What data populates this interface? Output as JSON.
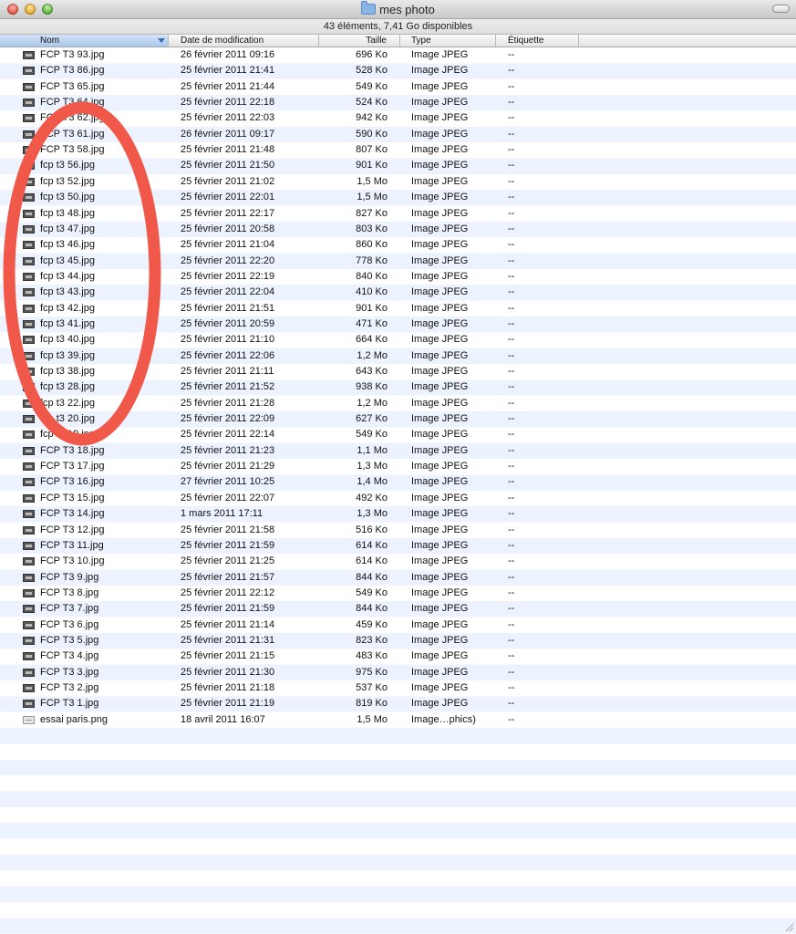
{
  "window": {
    "title": "mes photo"
  },
  "status": {
    "text": "43 éléments, 7,41 Go disponibles"
  },
  "columns": {
    "name": "Nom",
    "date": "Date de modification",
    "size": "Taille",
    "type": "Type",
    "label": "Étiquette"
  },
  "accent_color": "#f0584a",
  "files": [
    {
      "name": "FCP T3 93.jpg",
      "date": "26 février 2011 09:16",
      "size": "696 Ko",
      "type": "Image JPEG",
      "label": "--"
    },
    {
      "name": "FCP T3 86.jpg",
      "date": "25 février 2011 21:41",
      "size": "528 Ko",
      "type": "Image JPEG",
      "label": "--"
    },
    {
      "name": "FCP T3 65.jpg",
      "date": "25 février 2011 21:44",
      "size": "549 Ko",
      "type": "Image JPEG",
      "label": "--"
    },
    {
      "name": "FCP T3 64.jpg",
      "date": "25 février 2011 22:18",
      "size": "524 Ko",
      "type": "Image JPEG",
      "label": "--"
    },
    {
      "name": "FCP T3 62.jpg",
      "date": "25 février 2011 22:03",
      "size": "942 Ko",
      "type": "Image JPEG",
      "label": "--"
    },
    {
      "name": "FCP T3 61.jpg",
      "date": "26 février 2011 09:17",
      "size": "590 Ko",
      "type": "Image JPEG",
      "label": "--"
    },
    {
      "name": "FCP T3 58.jpg",
      "date": "25 février 2011 21:48",
      "size": "807 Ko",
      "type": "Image JPEG",
      "label": "--"
    },
    {
      "name": "fcp t3 56.jpg",
      "date": "25 février 2011 21:50",
      "size": "901 Ko",
      "type": "Image JPEG",
      "label": "--"
    },
    {
      "name": "fcp t3 52.jpg",
      "date": "25 février 2011 21:02",
      "size": "1,5 Mo",
      "type": "Image JPEG",
      "label": "--"
    },
    {
      "name": "fcp t3 50.jpg",
      "date": "25 février 2011 22:01",
      "size": "1,5 Mo",
      "type": "Image JPEG",
      "label": "--"
    },
    {
      "name": "fcp t3 48.jpg",
      "date": "25 février 2011 22:17",
      "size": "827 Ko",
      "type": "Image JPEG",
      "label": "--"
    },
    {
      "name": "fcp t3 47.jpg",
      "date": "25 février 2011 20:58",
      "size": "803 Ko",
      "type": "Image JPEG",
      "label": "--"
    },
    {
      "name": "fcp t3 46.jpg",
      "date": "25 février 2011 21:04",
      "size": "860 Ko",
      "type": "Image JPEG",
      "label": "--"
    },
    {
      "name": "fcp t3 45.jpg",
      "date": "25 février 2011 22:20",
      "size": "778 Ko",
      "type": "Image JPEG",
      "label": "--"
    },
    {
      "name": "fcp t3 44.jpg",
      "date": "25 février 2011 22:19",
      "size": "840 Ko",
      "type": "Image JPEG",
      "label": "--"
    },
    {
      "name": "fcp t3 43.jpg",
      "date": "25 février 2011 22:04",
      "size": "410 Ko",
      "type": "Image JPEG",
      "label": "--"
    },
    {
      "name": "fcp t3 42.jpg",
      "date": "25 février 2011 21:51",
      "size": "901 Ko",
      "type": "Image JPEG",
      "label": "--"
    },
    {
      "name": "fcp t3 41.jpg",
      "date": "25 février 2011 20:59",
      "size": "471 Ko",
      "type": "Image JPEG",
      "label": "--"
    },
    {
      "name": "fcp t3 40.jpg",
      "date": "25 février 2011 21:10",
      "size": "664 Ko",
      "type": "Image JPEG",
      "label": "--"
    },
    {
      "name": "fcp t3 39.jpg",
      "date": "25 février 2011 22:06",
      "size": "1,2 Mo",
      "type": "Image JPEG",
      "label": "--"
    },
    {
      "name": "fcp t3 38.jpg",
      "date": "25 février 2011 21:11",
      "size": "643 Ko",
      "type": "Image JPEG",
      "label": "--"
    },
    {
      "name": "fcp t3 28.jpg",
      "date": "25 février 2011 21:52",
      "size": "938 Ko",
      "type": "Image JPEG",
      "label": "--"
    },
    {
      "name": "fcp t3 22.jpg",
      "date": "25 février 2011 21:28",
      "size": "1,2 Mo",
      "type": "Image JPEG",
      "label": "--"
    },
    {
      "name": "fcp t3 20.jpg",
      "date": "25 février 2011 22:09",
      "size": "627 Ko",
      "type": "Image JPEG",
      "label": "--"
    },
    {
      "name": "fcp t3 19.jpg",
      "date": "25 février 2011 22:14",
      "size": "549 Ko",
      "type": "Image JPEG",
      "label": "--"
    },
    {
      "name": "FCP T3 18.jpg",
      "date": "25 février 2011 21:23",
      "size": "1,1 Mo",
      "type": "Image JPEG",
      "label": "--"
    },
    {
      "name": "FCP T3 17.jpg",
      "date": "25 février 2011 21:29",
      "size": "1,3 Mo",
      "type": "Image JPEG",
      "label": "--"
    },
    {
      "name": "FCP T3 16.jpg",
      "date": "27 février 2011 10:25",
      "size": "1,4 Mo",
      "type": "Image JPEG",
      "label": "--"
    },
    {
      "name": "FCP T3 15.jpg",
      "date": "25 février 2011 22:07",
      "size": "492 Ko",
      "type": "Image JPEG",
      "label": "--"
    },
    {
      "name": "FCP T3 14.jpg",
      "date": "1 mars 2011 17:11",
      "size": "1,3 Mo",
      "type": "Image JPEG",
      "label": "--"
    },
    {
      "name": "FCP T3 12.jpg",
      "date": "25 février 2011 21:58",
      "size": "516 Ko",
      "type": "Image JPEG",
      "label": "--"
    },
    {
      "name": "FCP T3 11.jpg",
      "date": "25 février 2011 21:59",
      "size": "614 Ko",
      "type": "Image JPEG",
      "label": "--"
    },
    {
      "name": "FCP T3 10.jpg",
      "date": "25 février 2011 21:25",
      "size": "614 Ko",
      "type": "Image JPEG",
      "label": "--"
    },
    {
      "name": "FCP T3 9.jpg",
      "date": "25 février 2011 21:57",
      "size": "844 Ko",
      "type": "Image JPEG",
      "label": "--"
    },
    {
      "name": "FCP T3 8.jpg",
      "date": "25 février 2011 22:12",
      "size": "549 Ko",
      "type": "Image JPEG",
      "label": "--"
    },
    {
      "name": "FCP T3 7.jpg",
      "date": "25 février 2011 21:59",
      "size": "844 Ko",
      "type": "Image JPEG",
      "label": "--"
    },
    {
      "name": "FCP T3 6.jpg",
      "date": "25 février 2011 21:14",
      "size": "459 Ko",
      "type": "Image JPEG",
      "label": "--"
    },
    {
      "name": "FCP T3 5.jpg",
      "date": "25 février 2011 21:31",
      "size": "823 Ko",
      "type": "Image JPEG",
      "label": "--"
    },
    {
      "name": "FCP T3 4.jpg",
      "date": "25 février 2011 21:15",
      "size": "483 Ko",
      "type": "Image JPEG",
      "label": "--"
    },
    {
      "name": "FCP T3 3.jpg",
      "date": "25 février 2011 21:30",
      "size": "975 Ko",
      "type": "Image JPEG",
      "label": "--"
    },
    {
      "name": "FCP T3 2.jpg",
      "date": "25 février 2011 21:18",
      "size": "537 Ko",
      "type": "Image JPEG",
      "label": "--"
    },
    {
      "name": "FCP T3 1.jpg",
      "date": "25 février 2011 21:19",
      "size": "819 Ko",
      "type": "Image JPEG",
      "label": "--"
    },
    {
      "name": "essai paris.png",
      "date": "18 avril 2011 16:07",
      "size": "1,5 Mo",
      "type": "Image…phics)",
      "label": "--"
    }
  ]
}
